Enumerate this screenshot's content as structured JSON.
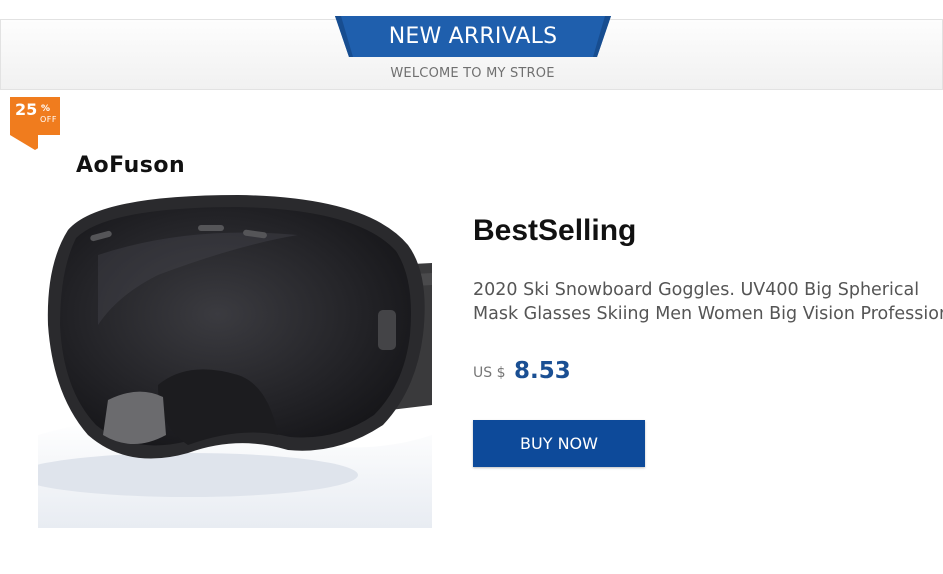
{
  "header": {
    "banner_title": "NEW ARRIVALS",
    "subtitle": "WELCOME TO MY STROE",
    "ribbon_color": "#1f5fad"
  },
  "badge": {
    "percent": "25",
    "symbol": "%",
    "off": "OFF",
    "color": "#f07c1e"
  },
  "product": {
    "brand": "AoFuson",
    "image_icon": "ski-goggles-image",
    "title": "BestSelling",
    "description_lines": [
      "2020 Ski Snowboard Goggles. UV400 Big Spherical",
      "Mask Glasses Skiing Men Women Big Vision Profession"
    ],
    "currency": "US $",
    "price": "8.53",
    "buy_label": "BUY NOW",
    "button_color": "#0d4a9a"
  }
}
